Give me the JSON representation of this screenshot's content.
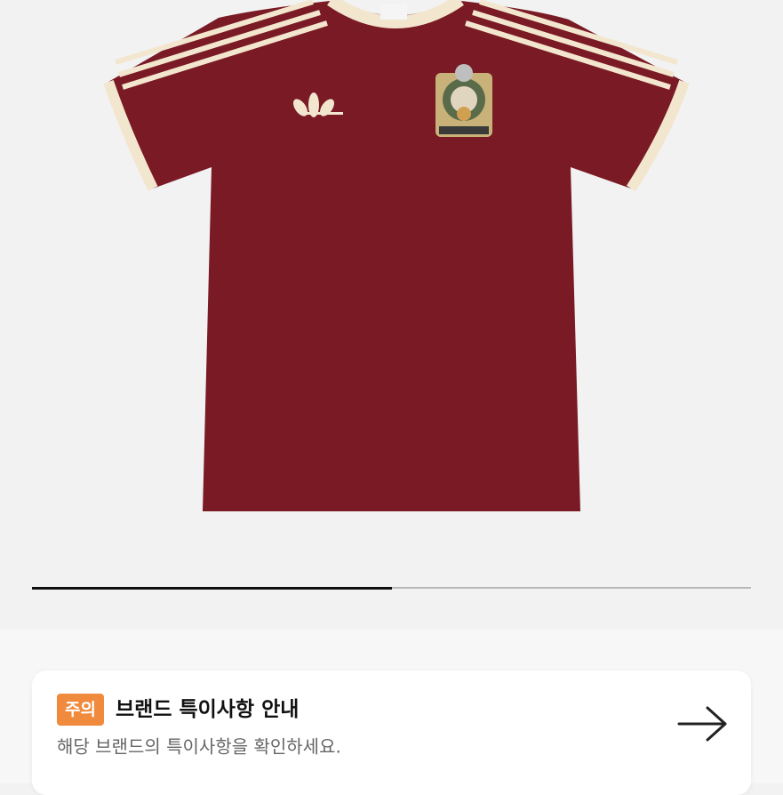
{
  "gallery": {
    "image_alt": "",
    "progress": 0.5,
    "colors": {
      "shirt": "#7a1a25",
      "trim": "#f3e6cf",
      "progress_fill": "#111111",
      "progress_track": "#b8b8b8"
    }
  },
  "notice": {
    "badge": "주의",
    "title": "브랜드 특이사항 안내",
    "description": "해당 브랜드의 특이사항을 확인하세요.",
    "arrow_icon": "arrow-right-icon",
    "badge_color": "#f08a3c"
  }
}
